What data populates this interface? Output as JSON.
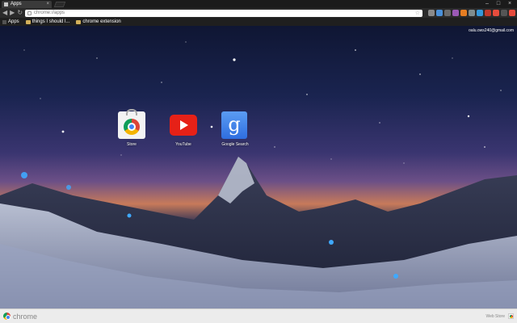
{
  "tab": {
    "title": "Apps"
  },
  "toolbar": {
    "url": "chrome://apps"
  },
  "bookmarks": [
    {
      "label": "Apps",
      "icon": "apps-grid-icon"
    },
    {
      "label": "things I should l...",
      "icon": "folder-icon"
    },
    {
      "label": "chrome extension",
      "icon": "folder-icon"
    }
  ],
  "user": {
    "email": "oalu.ows240@gmail.com"
  },
  "apps": [
    {
      "label": "Store",
      "icon": "chrome-web-store-icon"
    },
    {
      "label": "YouTube",
      "icon": "youtube-icon"
    },
    {
      "label": "Google Search",
      "icon": "google-search-icon"
    }
  ],
  "bottom": {
    "brand": "chrome",
    "webstore": "Web Store"
  },
  "colors": {
    "extensions": [
      "#8a8a8a",
      "#4a90d9",
      "#6b6b6b",
      "#9b59b6",
      "#e67e22",
      "#7f8c8d",
      "#3498db",
      "#c0392b",
      "#e74c3c",
      "#555555",
      "#e74c3c"
    ]
  }
}
